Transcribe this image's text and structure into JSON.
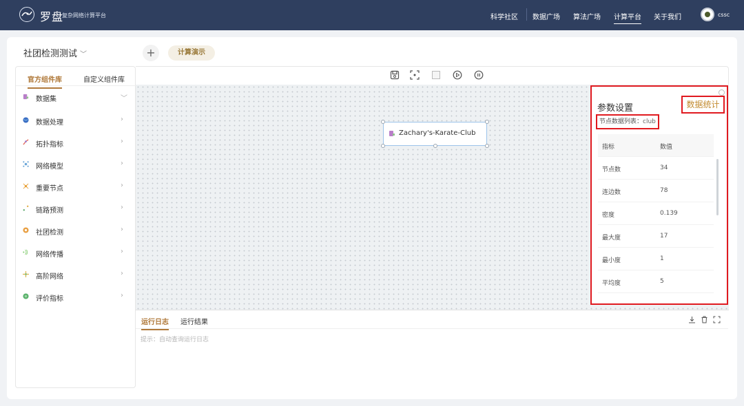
{
  "app": {
    "logo_name": "罗盘",
    "logo_subtitle": "复杂网络计算平台"
  },
  "nav": {
    "items": [
      "科学社区",
      "数据广场",
      "算法广场",
      "计算平台",
      "关于我们"
    ],
    "active": "计算平台",
    "user": "cssc"
  },
  "project": {
    "title": "社团检测测试",
    "add_label": "+",
    "tab_label": "计算演示"
  },
  "library": {
    "tabs": [
      "官方组件库",
      "自定义组件库"
    ],
    "categories": [
      {
        "label": "数据集",
        "icon": "database-icon",
        "color": "#b97fc9",
        "arrow": "﹀"
      },
      {
        "label": "数据处理",
        "icon": "globe-icon",
        "color": "#3b6fc4",
        "arrow": "›"
      },
      {
        "label": "拓扑指标",
        "icon": "topology-icon",
        "color": "#e4685a",
        "arrow": "›"
      },
      {
        "label": "网络模型",
        "icon": "network-model-icon",
        "color": "#6aa6d8",
        "arrow": "›"
      },
      {
        "label": "重要节点",
        "icon": "key-node-icon",
        "color": "#e8a23a",
        "arrow": "›"
      },
      {
        "label": "链路预测",
        "icon": "link-prediction-icon",
        "color": "#e0a93d",
        "arrow": "›"
      },
      {
        "label": "社团检测",
        "icon": "community-icon",
        "color": "#e9a043",
        "arrow": "›"
      },
      {
        "label": "网络传播",
        "icon": "propagation-icon",
        "color": "#8ccf7a",
        "arrow": "›"
      },
      {
        "label": "高阶网络",
        "icon": "higher-order-icon",
        "color": "#e0b24a",
        "arrow": "›"
      },
      {
        "label": "评价指标",
        "icon": "evaluation-icon",
        "color": "#59b26b",
        "arrow": "›"
      }
    ]
  },
  "canvas": {
    "toolbar_icons": [
      "save-icon",
      "fit-view-icon",
      "stop-icon",
      "run-icon",
      "pause-icon"
    ],
    "node": {
      "label": "Zachary's-Karate-Club",
      "icon": "database-icon"
    }
  },
  "params": {
    "title": "参数设置",
    "stats_button": "数据统计",
    "node_list_label": "节点数据列表：",
    "node_list_value": "club",
    "table_header": [
      "指标",
      "数值"
    ],
    "rows": [
      {
        "metric": "节点数",
        "value": "34"
      },
      {
        "metric": "连边数",
        "value": "78"
      },
      {
        "metric": "密度",
        "value": "0.139"
      },
      {
        "metric": "最大度",
        "value": "17"
      },
      {
        "metric": "最小度",
        "value": "1"
      },
      {
        "metric": "平均度",
        "value": "5"
      }
    ]
  },
  "log": {
    "tabs": [
      "运行日志",
      "运行结果"
    ],
    "hint": "提示：自动查询运行日志",
    "tool_icons": [
      "download-icon",
      "delete-icon",
      "fullscreen-icon"
    ]
  }
}
